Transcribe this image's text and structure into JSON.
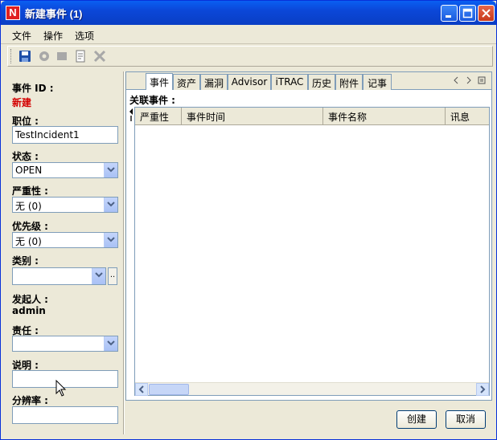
{
  "window": {
    "title": "新建事件 (1)",
    "app_icon_letter": "N"
  },
  "menu": [
    "文件",
    "操作",
    "选项"
  ],
  "toolbar": {
    "icons": [
      "save-icon",
      "gear-icon",
      "stop-icon",
      "report-icon",
      "delete-icon"
    ]
  },
  "form": {
    "incident_id_label": "事件 ID :",
    "incident_id_value": "新建",
    "position_label": "职位 :",
    "position_value": "TestIncident1",
    "status_label": "状态 :",
    "status_value": "OPEN",
    "severity_label": "严重性 :",
    "severity_value": "无 (0)",
    "priority_label": "优先级 :",
    "priority_value": "无 (0)",
    "category_label": "类别 :",
    "category_value": "",
    "browse_label": "..",
    "originator_label": "发起人 :",
    "originator_value": "admin",
    "owner_label": "责任 :",
    "owner_value": "",
    "description_label": "说明 :",
    "description_value": "",
    "resolution_label": "分辨率 :",
    "resolution_value": ""
  },
  "tabs": [
    "事件",
    "资产",
    "漏洞",
    "Advisor",
    "iTRAC",
    "历史",
    "附件",
    "记事"
  ],
  "active_tab": 0,
  "related": {
    "section_label": "关联事件 :",
    "columns": [
      "严重性",
      "事件时间",
      "事件名称",
      "讯息"
    ]
  },
  "buttons": {
    "create": "创建",
    "cancel": "取消"
  },
  "colors": {
    "title_bar": "#0b47d8",
    "required_red": "#d40000",
    "window_bg": "#ece9d8"
  }
}
